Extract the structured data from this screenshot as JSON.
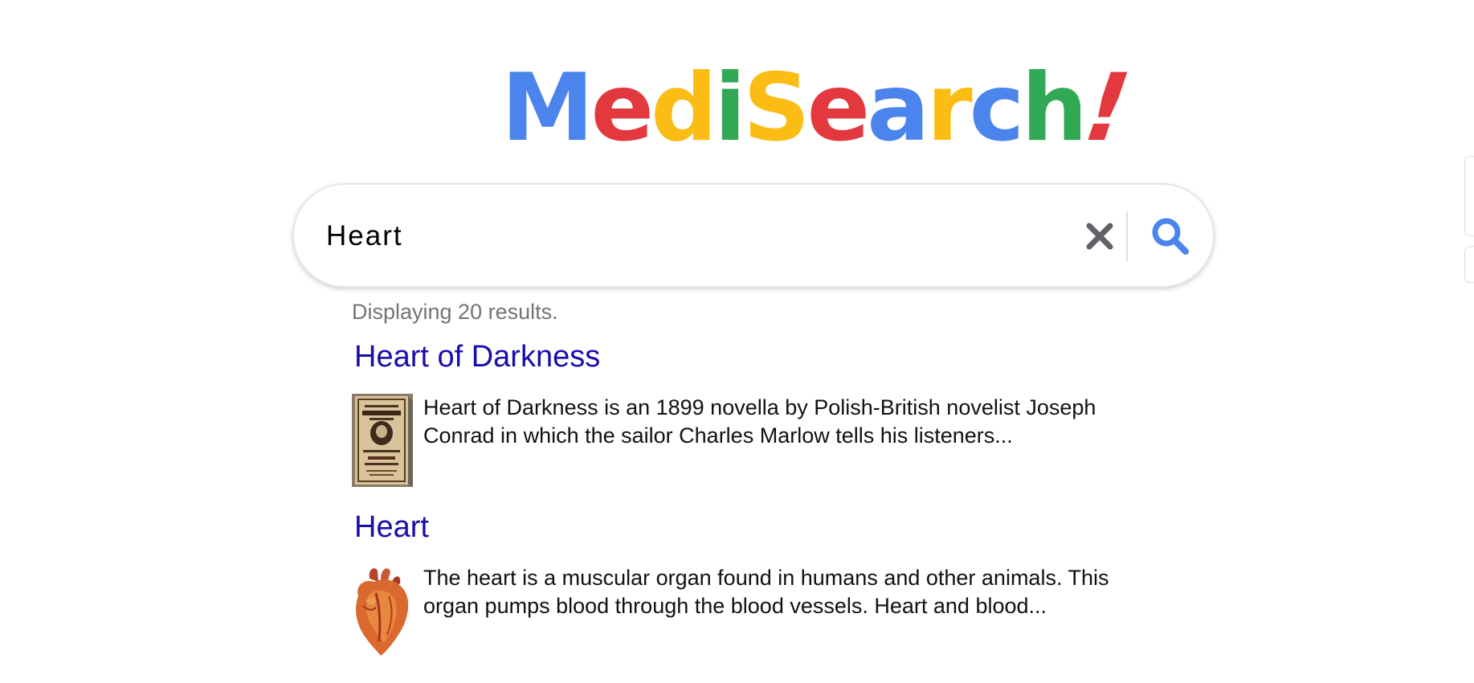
{
  "logo": {
    "letters": [
      {
        "ch": "M",
        "color": "#4a84ec"
      },
      {
        "ch": "e",
        "color": "#e2383e"
      },
      {
        "ch": "d",
        "color": "#fbbc14"
      },
      {
        "ch": "i",
        "color": "#31a853"
      },
      {
        "ch": "S",
        "color": "#fbbc14"
      },
      {
        "ch": "e",
        "color": "#e2383e"
      },
      {
        "ch": "a",
        "color": "#4a84ec"
      },
      {
        "ch": "r",
        "color": "#fbbc14"
      },
      {
        "ch": "c",
        "color": "#4a84ec"
      },
      {
        "ch": "h",
        "color": "#31a853"
      },
      {
        "ch": "!",
        "color": "#e2383e"
      }
    ]
  },
  "search": {
    "value": "Heart",
    "clear_icon": "close-icon",
    "submit_icon": "search-icon",
    "accent_color": "#4a84ec"
  },
  "results_summary": "Displaying 20 results.",
  "results": [
    {
      "title": "Heart of Darkness",
      "snippet": "Heart of Darkness is an 1899 novella by Polish-British novelist Joseph Conrad in which the sailor Charles Marlow tells his listeners...",
      "thumbnail": "book-cover-image"
    },
    {
      "title": "Heart",
      "snippet": "The heart is a muscular organ found in humans and other animals. This organ pumps blood through the blood vessels. Heart and blood...",
      "thumbnail": "anatomical-heart-image"
    }
  ],
  "colors": {
    "link": "#1a0dab",
    "muted": "#70757a"
  }
}
